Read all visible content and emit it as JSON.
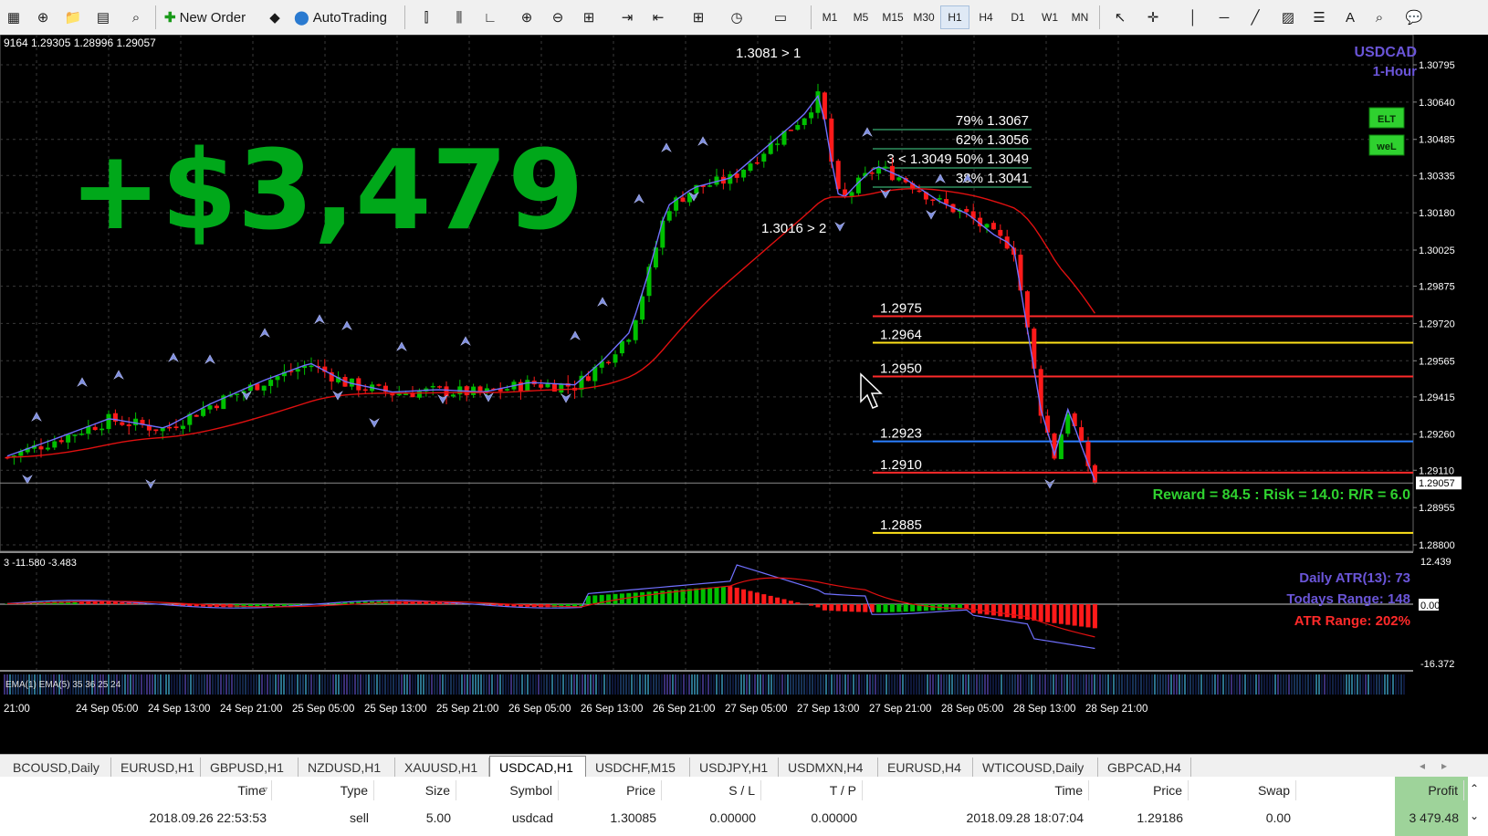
{
  "toolbar": {
    "new_order_label": "New Order",
    "autotrading_label": "AutoTrading",
    "timeframes": [
      "M1",
      "M5",
      "M15",
      "M30",
      "H1",
      "H4",
      "D1",
      "W1",
      "MN"
    ],
    "active_timeframe": "H1"
  },
  "chart": {
    "symbol": "USDCAD",
    "period": "1-Hour",
    "ohlc_header": "9164 1.29305 1.28996 1.29057",
    "big_profit": "+$3,479",
    "buttons": [
      "ELT",
      "weL"
    ],
    "price_scale": [
      "1.30795",
      "1.30640",
      "1.30485",
      "1.30335",
      "1.30180",
      "1.30025",
      "1.29875",
      "1.29720",
      "1.29565",
      "1.29415",
      "1.29260",
      "1.29110",
      "1.29057",
      "1.28955",
      "1.28800"
    ],
    "current_price": "1.29057",
    "peak_label": "1.3081 > 1",
    "low_label": "1.3016 > 2",
    "fib_levels": [
      {
        "label": "79% 1.3067"
      },
      {
        "label": "62% 1.3056"
      },
      {
        "label": "3 < 1.3049 50% 1.3049"
      },
      {
        "label": "38% 1.3041"
      }
    ],
    "levels": [
      {
        "label": "1.2975",
        "color": "#ff2a2a"
      },
      {
        "label": "1.2964",
        "color": "#ffe21a"
      },
      {
        "label": "1.2950",
        "color": "#ff2a2a"
      },
      {
        "label": "1.2923",
        "color": "#2a7fff"
      },
      {
        "label": "1.2910",
        "color": "#ff2a2a"
      },
      {
        "label": "1.2885",
        "color": "#ffe21a"
      }
    ],
    "reward_risk": "Reward = 84.5 : Risk = 14.0: R/R = 6.0",
    "time_axis": [
      "21:00",
      "24 Sep 05:00",
      "24 Sep 13:00",
      "24 Sep 21:00",
      "25 Sep 05:00",
      "25 Sep 13:00",
      "25 Sep 21:00",
      "26 Sep 05:00",
      "26 Sep 13:00",
      "26 Sep 21:00",
      "27 Sep 05:00",
      "27 Sep 13:00",
      "27 Sep 21:00",
      "28 Sep 05:00",
      "28 Sep 13:00",
      "28 Sep 21:00"
    ],
    "colors": {
      "bull": "#00c000",
      "bear": "#ff1a1a",
      "fast_ma": "#7070ff",
      "slow_ma": "#e01010",
      "fib": "#2f8f5f",
      "profit_text": "#00a81a"
    }
  },
  "indicator": {
    "header": "3 -11.580 -3.483",
    "daily_atr": "Daily ATR(13): 73",
    "todays_range": "Todays Range: 148",
    "atr_range": "ATR Range: 202%",
    "scale_top": "12.439",
    "scale_mid": "0.00",
    "scale_bottom": "-16.372",
    "strip_label": "EMA(1) EMA(5) 35 36 25 24"
  },
  "tabs": [
    "BCOUSD,Daily",
    "EURUSD,H1",
    "GBPUSD,H1",
    "NZDUSD,H1",
    "XAUUSD,H1",
    "USDCAD,H1",
    "USDCHF,M15",
    "USDJPY,H1",
    "USDMXN,H4",
    "EURUSD,H4",
    "WTICOUSD,Daily",
    "GBPCAD,H4"
  ],
  "active_tab": "USDCAD,H1",
  "trade_table": {
    "headers": [
      "Time",
      "Type",
      "Size",
      "Symbol",
      "Price",
      "S / L",
      "T / P",
      "Time",
      "Price",
      "Swap",
      "Profit"
    ],
    "row": [
      "2018.09.26 22:53:53",
      "sell",
      "5.00",
      "usdcad",
      "1.30085",
      "0.00000",
      "0.00000",
      "2018.09.28 18:07:04",
      "1.29186",
      "0.00",
      "3 479.48"
    ]
  }
}
